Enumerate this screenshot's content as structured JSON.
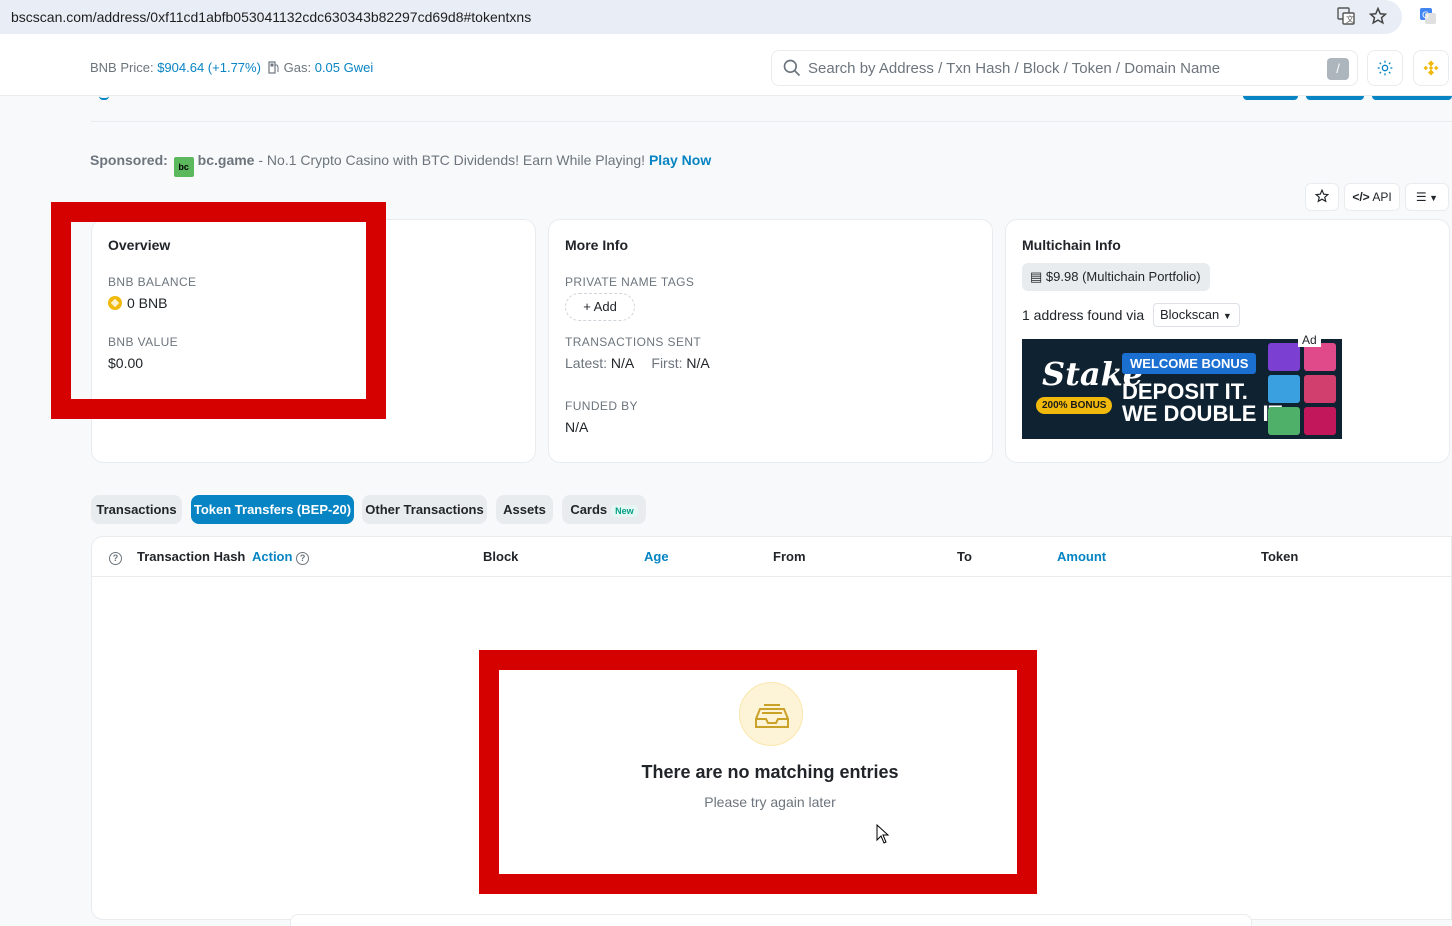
{
  "browser": {
    "url": "bscscan.com/address/0xf11cd1abfb053041132cdc630343b82297cd69d8#tokentxns"
  },
  "header": {
    "price_label": "BNB Price:",
    "price_value": "$904.64 (+1.77%)",
    "gas_label": "Gas:",
    "gas_value": "0.05 Gwei",
    "search_placeholder": "Search by Address / Txn Hash / Block / Token / Domain Name",
    "search_shortcut": "/"
  },
  "sponsored": {
    "label": "Sponsored:",
    "brand": "bc.game",
    "text": " - No.1 Crypto Casino with BTC Dividends! Earn While Playing! ",
    "cta": "Play Now"
  },
  "tools": {
    "api_label": "API"
  },
  "overview": {
    "title": "Overview",
    "balance_label": "BNB BALANCE",
    "balance_value": "0 BNB",
    "value_label": "BNB VALUE",
    "value_value": "$0.00"
  },
  "more_info": {
    "title": "More Info",
    "tags_label": "PRIVATE NAME TAGS",
    "add_label": "+ Add",
    "sent_label": "TRANSACTIONS SENT",
    "latest_label": "Latest:",
    "latest_value": "N/A",
    "first_label": "First:",
    "first_value": "N/A",
    "funded_label": "FUNDED BY",
    "funded_value": "N/A"
  },
  "multichain": {
    "title": "Multichain Info",
    "portfolio": "$9.98 (Multichain Portfolio)",
    "via_text": "1 address found via",
    "via_select": "Blockscan",
    "ad_tag": "Ad",
    "ad_brand": "Stake",
    "ad_badge": "200% BONUS",
    "ad_headline": "WELCOME BONUS",
    "ad_line1": "DEPOSIT IT.",
    "ad_line2": "WE DOUBLE IT."
  },
  "tabs": [
    {
      "label": "Transactions",
      "active": false
    },
    {
      "label": "Token Transfers (BEP-20)",
      "active": true
    },
    {
      "label": "Other Transactions",
      "active": false
    },
    {
      "label": "Assets",
      "active": false
    },
    {
      "label": "Cards",
      "active": false,
      "badge": "New"
    }
  ],
  "table": {
    "columns": [
      "Transaction Hash",
      "Action",
      "Block",
      "Age",
      "From",
      "To",
      "Amount",
      "Token"
    ],
    "empty_title": "There are no matching entries",
    "empty_subtitle": "Please try again later"
  },
  "colors": {
    "accent": "#0784c3",
    "annotation": "#d50000"
  }
}
